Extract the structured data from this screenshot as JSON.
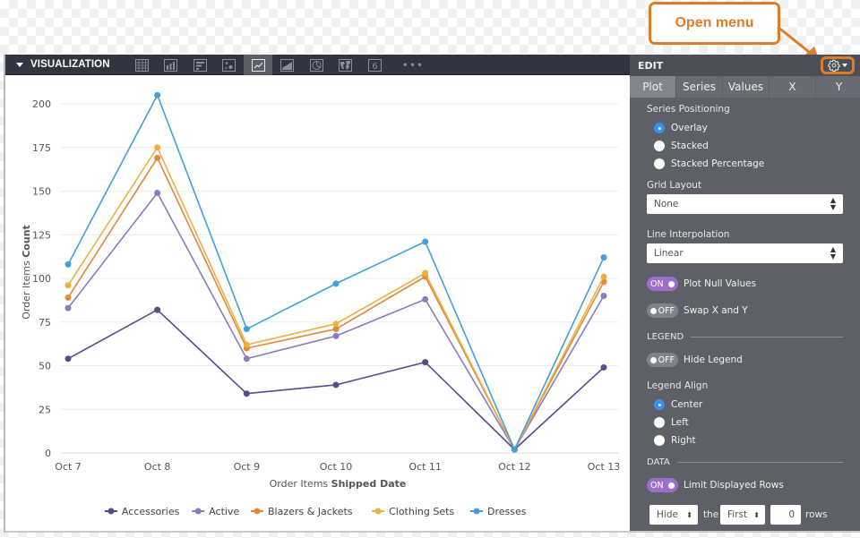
{
  "callout": {
    "label": "Open menu",
    "color": "#e07b29"
  },
  "viz_panel": {
    "title": "VISUALIZATION",
    "toolbar_icons": [
      {
        "name": "table-icon",
        "active": false
      },
      {
        "name": "column-chart-icon",
        "active": false
      },
      {
        "name": "bar-chart-icon",
        "active": false
      },
      {
        "name": "scatter-chart-icon",
        "active": false
      },
      {
        "name": "line-chart-icon",
        "active": true
      },
      {
        "name": "area-chart-icon",
        "active": false
      },
      {
        "name": "pie-chart-icon",
        "active": false
      },
      {
        "name": "map-icon",
        "active": false
      },
      {
        "name": "single-value-icon",
        "active": false,
        "glyph": "6"
      }
    ],
    "more_label": "•••"
  },
  "edit_panel": {
    "title": "EDIT",
    "tabs": [
      {
        "label": "Plot",
        "active": true
      },
      {
        "label": "Series",
        "active": false
      },
      {
        "label": "Values",
        "active": false
      },
      {
        "label": "X",
        "active": false
      },
      {
        "label": "Y",
        "active": false
      }
    ],
    "series_positioning": {
      "label": "Series Positioning",
      "options": [
        {
          "label": "Overlay",
          "checked": true
        },
        {
          "label": "Stacked",
          "checked": false
        },
        {
          "label": "Stacked Percentage",
          "checked": false
        }
      ]
    },
    "grid_layout": {
      "label": "Grid Layout",
      "value": "None"
    },
    "line_interpolation": {
      "label": "Line Interpolation",
      "value": "Linear"
    },
    "plot_null_values": {
      "label": "Plot Null Values",
      "state": "ON"
    },
    "swap_xy": {
      "label": "Swap X and Y",
      "state": "OFF"
    },
    "legend_section": "LEGEND",
    "hide_legend": {
      "label": "Hide Legend",
      "state": "OFF"
    },
    "legend_align": {
      "label": "Legend Align",
      "options": [
        {
          "label": "Center",
          "checked": true
        },
        {
          "label": "Left",
          "checked": false
        },
        {
          "label": "Right",
          "checked": false
        }
      ]
    },
    "data_section": "DATA",
    "limit_rows": {
      "label": "Limit Displayed Rows",
      "state": "ON"
    },
    "row_limit": {
      "action": "Hide",
      "the_label": "the",
      "position": "First",
      "count": "0",
      "rows_label": "rows"
    }
  },
  "chart_data": {
    "type": "line",
    "title": "",
    "xlabel_prefix": "Order Items ",
    "xlabel_bold": "Shipped Date",
    "ylabel_prefix": "Order Items ",
    "ylabel_bold": "Count",
    "categories": [
      "Oct 7",
      "Oct 8",
      "Oct 9",
      "Oct 10",
      "Oct 11",
      "Oct 12",
      "Oct 13"
    ],
    "ylim": [
      0,
      210
    ],
    "yticks": [
      0,
      25,
      50,
      75,
      100,
      125,
      150,
      175,
      200
    ],
    "grid": true,
    "legend_position": "bottom-center",
    "series": [
      {
        "name": "Accessories",
        "color": "#5a4a8a",
        "values": [
          54,
          82,
          34,
          39,
          52,
          2,
          49
        ]
      },
      {
        "name": "Active",
        "color": "#8c7bbf",
        "values": [
          83,
          149,
          54,
          67,
          88,
          2,
          90
        ]
      },
      {
        "name": "Blazers & Jackets",
        "color": "#e2873b",
        "values": [
          89,
          169,
          60,
          71,
          101,
          2,
          98
        ]
      },
      {
        "name": "Clothing Sets",
        "color": "#ebb143",
        "values": [
          96,
          175,
          62,
          74,
          103,
          2,
          101
        ]
      },
      {
        "name": "Dresses",
        "color": "#3fa1db",
        "values": [
          108,
          205,
          71,
          97,
          121,
          2,
          112
        ]
      }
    ]
  }
}
